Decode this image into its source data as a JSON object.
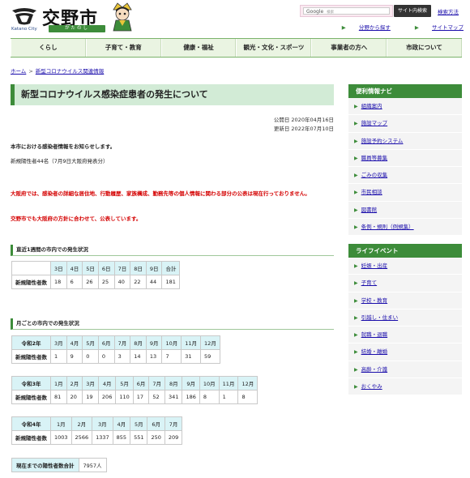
{
  "header": {
    "logo_text": "交野市",
    "logo_en": "Katano City",
    "logo_jp": "かたのし",
    "search_brand": "Google",
    "search_placeholder": "検索",
    "search_button": "サイト内検索",
    "detail_search": "検索方法",
    "sublinks": [
      "分野から探す",
      "サイトマップ"
    ]
  },
  "nav": [
    "くらし",
    "子育て・教育",
    "健康・福祉",
    "観光・文化・スポーツ",
    "事業者の方へ",
    "市政について"
  ],
  "breadcrumb": {
    "home": "ホーム",
    "current": "新型コロナウイルス関連情報"
  },
  "main": {
    "title": "新型コロナウイルス感染症患者の発生について",
    "published": "公開日 2020年04月16日",
    "updated": "更新日 2022年07月10日",
    "intro": "本市における感染者情報をお知らせします。",
    "new_cases": "新規陽性者44名（7月9日大阪府発表分）",
    "notice1": "大阪府では、感染者の詳細な居住地、行動履歴、家族構成、勤務先等の個人情報に関わる部分の公表は現在行っておりません。",
    "notice2": "交野市でも大阪府の方針に合わせて、公表しています。",
    "weekly_heading": "直近1週間の市内での発生状況",
    "weekly": {
      "headers": [
        "3日",
        "4日",
        "5日",
        "6日",
        "7日",
        "8日",
        "9日",
        "合計"
      ],
      "row_label": "新規陽性者数",
      "values": [
        "18",
        "6",
        "26",
        "25",
        "40",
        "22",
        "44",
        "181"
      ]
    },
    "monthly_heading": "月ごとの市内での発生状況",
    "r2": {
      "year": "令和2年",
      "headers": [
        "3月",
        "4月",
        "5月",
        "6月",
        "7月",
        "8月",
        "9月",
        "10月",
        "11月",
        "12月"
      ],
      "row_label": "新規陽性者数",
      "values": [
        "1",
        "9",
        "0",
        "0",
        "3",
        "14",
        "13",
        "7",
        "31",
        "59"
      ]
    },
    "r3": {
      "year": "令和3年",
      "headers": [
        "1月",
        "2月",
        "3月",
        "4月",
        "5月",
        "6月",
        "7月",
        "8月",
        "9月",
        "10月",
        "11月",
        "12月"
      ],
      "row_label": "新規陽性者数",
      "values": [
        "81",
        "20",
        "19",
        "206",
        "110",
        "17",
        "52",
        "341",
        "186",
        "8",
        "1",
        "8"
      ]
    },
    "r4": {
      "year": "令和4年",
      "headers": [
        "1月",
        "2月",
        "3月",
        "4月",
        "5月",
        "6月",
        "7月"
      ],
      "row_label": "新規陽性者数",
      "values": [
        "1003",
        "2566",
        "1337",
        "855",
        "551",
        "250",
        "209"
      ]
    },
    "total_label": "現在までの陽性者数合計",
    "total_value": "7957人"
  },
  "sidebar": {
    "nav_title": "便利情報ナビ",
    "nav_items": [
      "組織案内",
      "施設マップ",
      "施設予約システム",
      "職員等募集",
      "ごみの収集",
      "市民相談",
      "図書館",
      "条例・規則（例規集）"
    ],
    "life_title": "ライフイベント",
    "life_items": [
      "妊娠・出産",
      "子育て",
      "学校・教育",
      "引越し・住まい",
      "就職・退職",
      "結婚・離婚",
      "高齢・介護",
      "おくやみ"
    ]
  },
  "colors": {
    "brand_green": "#3d8c3a",
    "title_bg": "#d2ebd6",
    "table_head": "#d9f3f6",
    "notice_red": "#d40000"
  }
}
